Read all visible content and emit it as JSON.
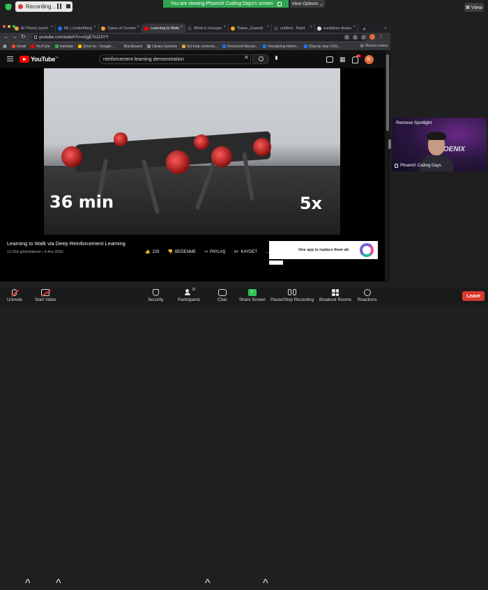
{
  "zoom": {
    "recording_label": "Recording...",
    "viewing_banner": "You are viewing PhoeniX Coding Days's screen",
    "view_options_label": "View Options",
    "view_label": "View"
  },
  "browser": {
    "tabs": [
      {
        "label": "AI Theory öyreh"
      },
      {
        "label": "ML | Underfitting"
      },
      {
        "label": "Types of Clusteri"
      },
      {
        "label": "Learning to Walk"
      },
      {
        "label": "What is Unsuper"
      },
      {
        "label": "Titanic_Exampl"
      },
      {
        "label": "untitled - Paint"
      },
      {
        "label": "euclidean distan"
      }
    ],
    "active_tab_index": 3,
    "url": "youtube.com/watch?v=n2gE7n11hYY",
    "profile_initial": "B",
    "bookmarks": [
      "Gmail",
      "YouTube",
      "Haritalar",
      "Drive'ım - Google...",
      "Blackboard",
      "Library Genesis",
      "Sci-Hub: removin...",
      "Recurrent Neural...",
      "Visualizing interm...",
      "Step by step VGG..."
    ],
    "reading_list": "Okuma Listesi"
  },
  "youtube": {
    "brand": "YouTube",
    "brand_suffix": "TR",
    "search_value": "reinforcement learning demonstration",
    "notification_count": "9+",
    "avatar_initial": "B",
    "video_overlay_time": "36 min",
    "video_overlay_speed": "5x",
    "video_title": "Learning to Walk via Deep Reinforcement Learning",
    "video_meta": "12.659 görüntüleme • 4 Ara 2020",
    "likes": "229",
    "dislike_label": "BEĞENME",
    "share_label": "PAYLAŞ",
    "save_label": "KAYDET",
    "more_label": "...",
    "ad_text": "One app to replace them all."
  },
  "participant": {
    "remove_spotlight": "Remove Spotlight",
    "name": "PhoeniX Coding Days",
    "brand_mark": "PHOENIX"
  },
  "toolbar": {
    "unmute": "Unmute",
    "start_video": "Start Video",
    "security": "Security",
    "participants": "Participants",
    "participant_count": "32",
    "chat": "Chat",
    "share_screen": "Share Screen",
    "recording": "Pause/Stop Recording",
    "breakout": "Breakout Rooms",
    "reactions": "Reactions",
    "leave": "Leave"
  },
  "colors": {
    "banner_green": "#2ea44f",
    "leave_red": "#d83a2f",
    "youtube_red": "#ff0000",
    "share_green": "#2fc45a"
  }
}
